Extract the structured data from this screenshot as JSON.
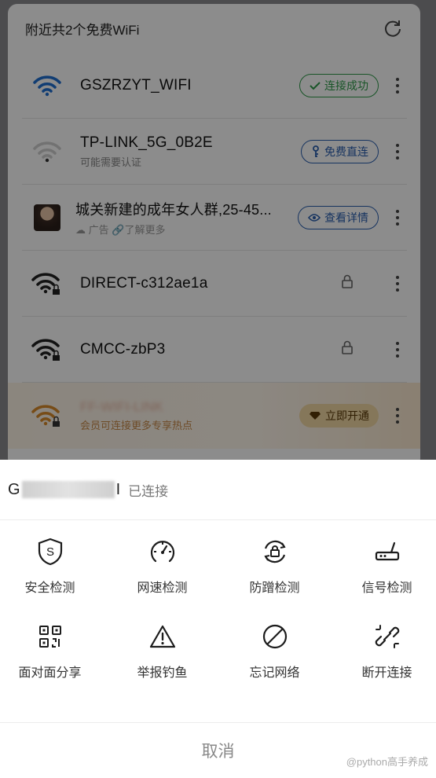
{
  "list": {
    "title": "附近共2个免费WiFi",
    "networks": [
      {
        "name": "GSZRZYT_WIFI",
        "sub": "",
        "badge": "连接成功",
        "badge_style": "green"
      },
      {
        "name": "TP-LINK_5G_0B2E",
        "sub": "可能需要认证",
        "badge": "免费直连",
        "badge_style": "blue"
      },
      {
        "name": "城关新建的成年女人群,25-45...",
        "sub": "广告",
        "sub2": "了解更多",
        "badge": "查看详情",
        "badge_style": "blue",
        "ad": true
      },
      {
        "name": "DIRECT-c312ae1a",
        "sub": "",
        "badge": "",
        "locked": true
      },
      {
        "name": "CMCC-zbP3",
        "sub": "",
        "badge": "",
        "locked": true
      },
      {
        "name": "FF-WIFI-LINK",
        "sub": "会员可连接更多专享热点",
        "badge": "立即开通",
        "badge_style": "gold",
        "locked": true
      }
    ]
  },
  "sheet": {
    "ssid_start": "G",
    "ssid_end": "I",
    "status": "已连接",
    "actions": [
      {
        "label": "安全检测",
        "icon": "shield-s-icon"
      },
      {
        "label": "网速检测",
        "icon": "speedometer-icon"
      },
      {
        "label": "防蹭检测",
        "icon": "anti-leech-lock-icon"
      },
      {
        "label": "信号检测",
        "icon": "router-icon"
      },
      {
        "label": "面对面分享",
        "icon": "qr-code-icon"
      },
      {
        "label": "举报钓鱼",
        "icon": "warning-icon"
      },
      {
        "label": "忘记网络",
        "icon": "forbidden-icon"
      },
      {
        "label": "断开连接",
        "icon": "broken-link-icon"
      }
    ],
    "cancel": "取消"
  },
  "watermark": "@python高手养成",
  "colors": {
    "green": "#2e9b49",
    "blue": "#2a5fb0",
    "wifi_blue": "#1f6fd1",
    "gold": "#d98a2b"
  }
}
